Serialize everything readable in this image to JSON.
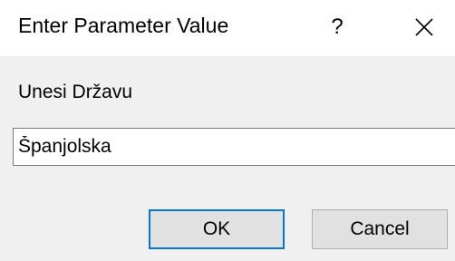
{
  "window": {
    "title": "Enter Parameter Value",
    "help_label": "?",
    "close_icon": "close-icon"
  },
  "form": {
    "prompt": "Unesi Državu",
    "value": "Španjolska"
  },
  "buttons": {
    "ok_label": "OK",
    "cancel_label": "Cancel"
  },
  "colors": {
    "body_background": "#f0f0f0",
    "default_button_border": "#0078d7"
  }
}
